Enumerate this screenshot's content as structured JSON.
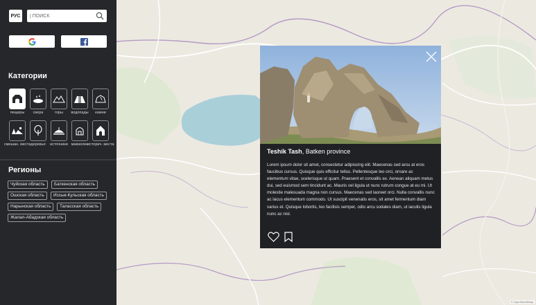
{
  "header": {
    "lang_label": "РУС",
    "search_placeholder": "| ПОИСК"
  },
  "social": {
    "google_icon": "google-icon",
    "facebook_icon": "facebook-icon"
  },
  "categories": {
    "title": "Категории",
    "items": [
      {
        "label": "пещеры",
        "icon": "cave-icon",
        "active": true
      },
      {
        "label": "озера",
        "icon": "lake-icon",
        "active": false
      },
      {
        "label": "горы",
        "icon": "mountains-icon",
        "active": false
      },
      {
        "label": "водопады",
        "icon": "waterfall-icon",
        "active": false
      },
      {
        "label": "камни",
        "icon": "stone-icon",
        "active": false
      },
      {
        "label": "смешан. места",
        "icon": "mixed-places-icon",
        "active": false
      },
      {
        "label": "деревья",
        "icon": "tree-icon",
        "active": false
      },
      {
        "label": "источники",
        "icon": "spring-icon",
        "active": false
      },
      {
        "label": "мавзолеи",
        "icon": "mausoleum-icon",
        "active": false
      },
      {
        "label": "историч. места",
        "icon": "historic-place-icon",
        "active": false
      }
    ]
  },
  "regions": {
    "title": "Регионы",
    "items": [
      "Чуйская область",
      "Баткенская область",
      "Ошская область",
      "Иссык-Кульская область",
      "Нарынская область",
      "Таласская область",
      "Жалал-Абадская область"
    ]
  },
  "popup": {
    "title_bold": "Teshik Tash",
    "title_rest": ", Batken province",
    "description": "Lorem ipsum dolor sit amet, consectetur adipiscing elit. Maecenas sed arcu at eros faucibus cursus. Quisque quis efficitur tellus. Pellentesque leo orci, ornare ac elementum vitae, scelerisque ut quam. Praesent et convallis ex. Aenean aliquam metus dui, sed euismod sem tincidunt ac. Mauris vel ligula ut nunc rutrum congue at eu mi. Ut molestie malesuada magna non cursus. Maecenas sed laoreet orci. Nulla convallis nunc ac lacus elementum commodo. Ut suscipit venenatis eros, sit amet fermentum diam varius et. Quisque lobortis, leo facilisis semper, odio arcu sodales diam, ut iaculis ligula nunc ac nisl."
  },
  "map": {
    "attribution": "© OpenStreetMap",
    "lake_color": "#a9cfd9",
    "border_color": "#b49ac4",
    "road_color": "#ffffff"
  }
}
